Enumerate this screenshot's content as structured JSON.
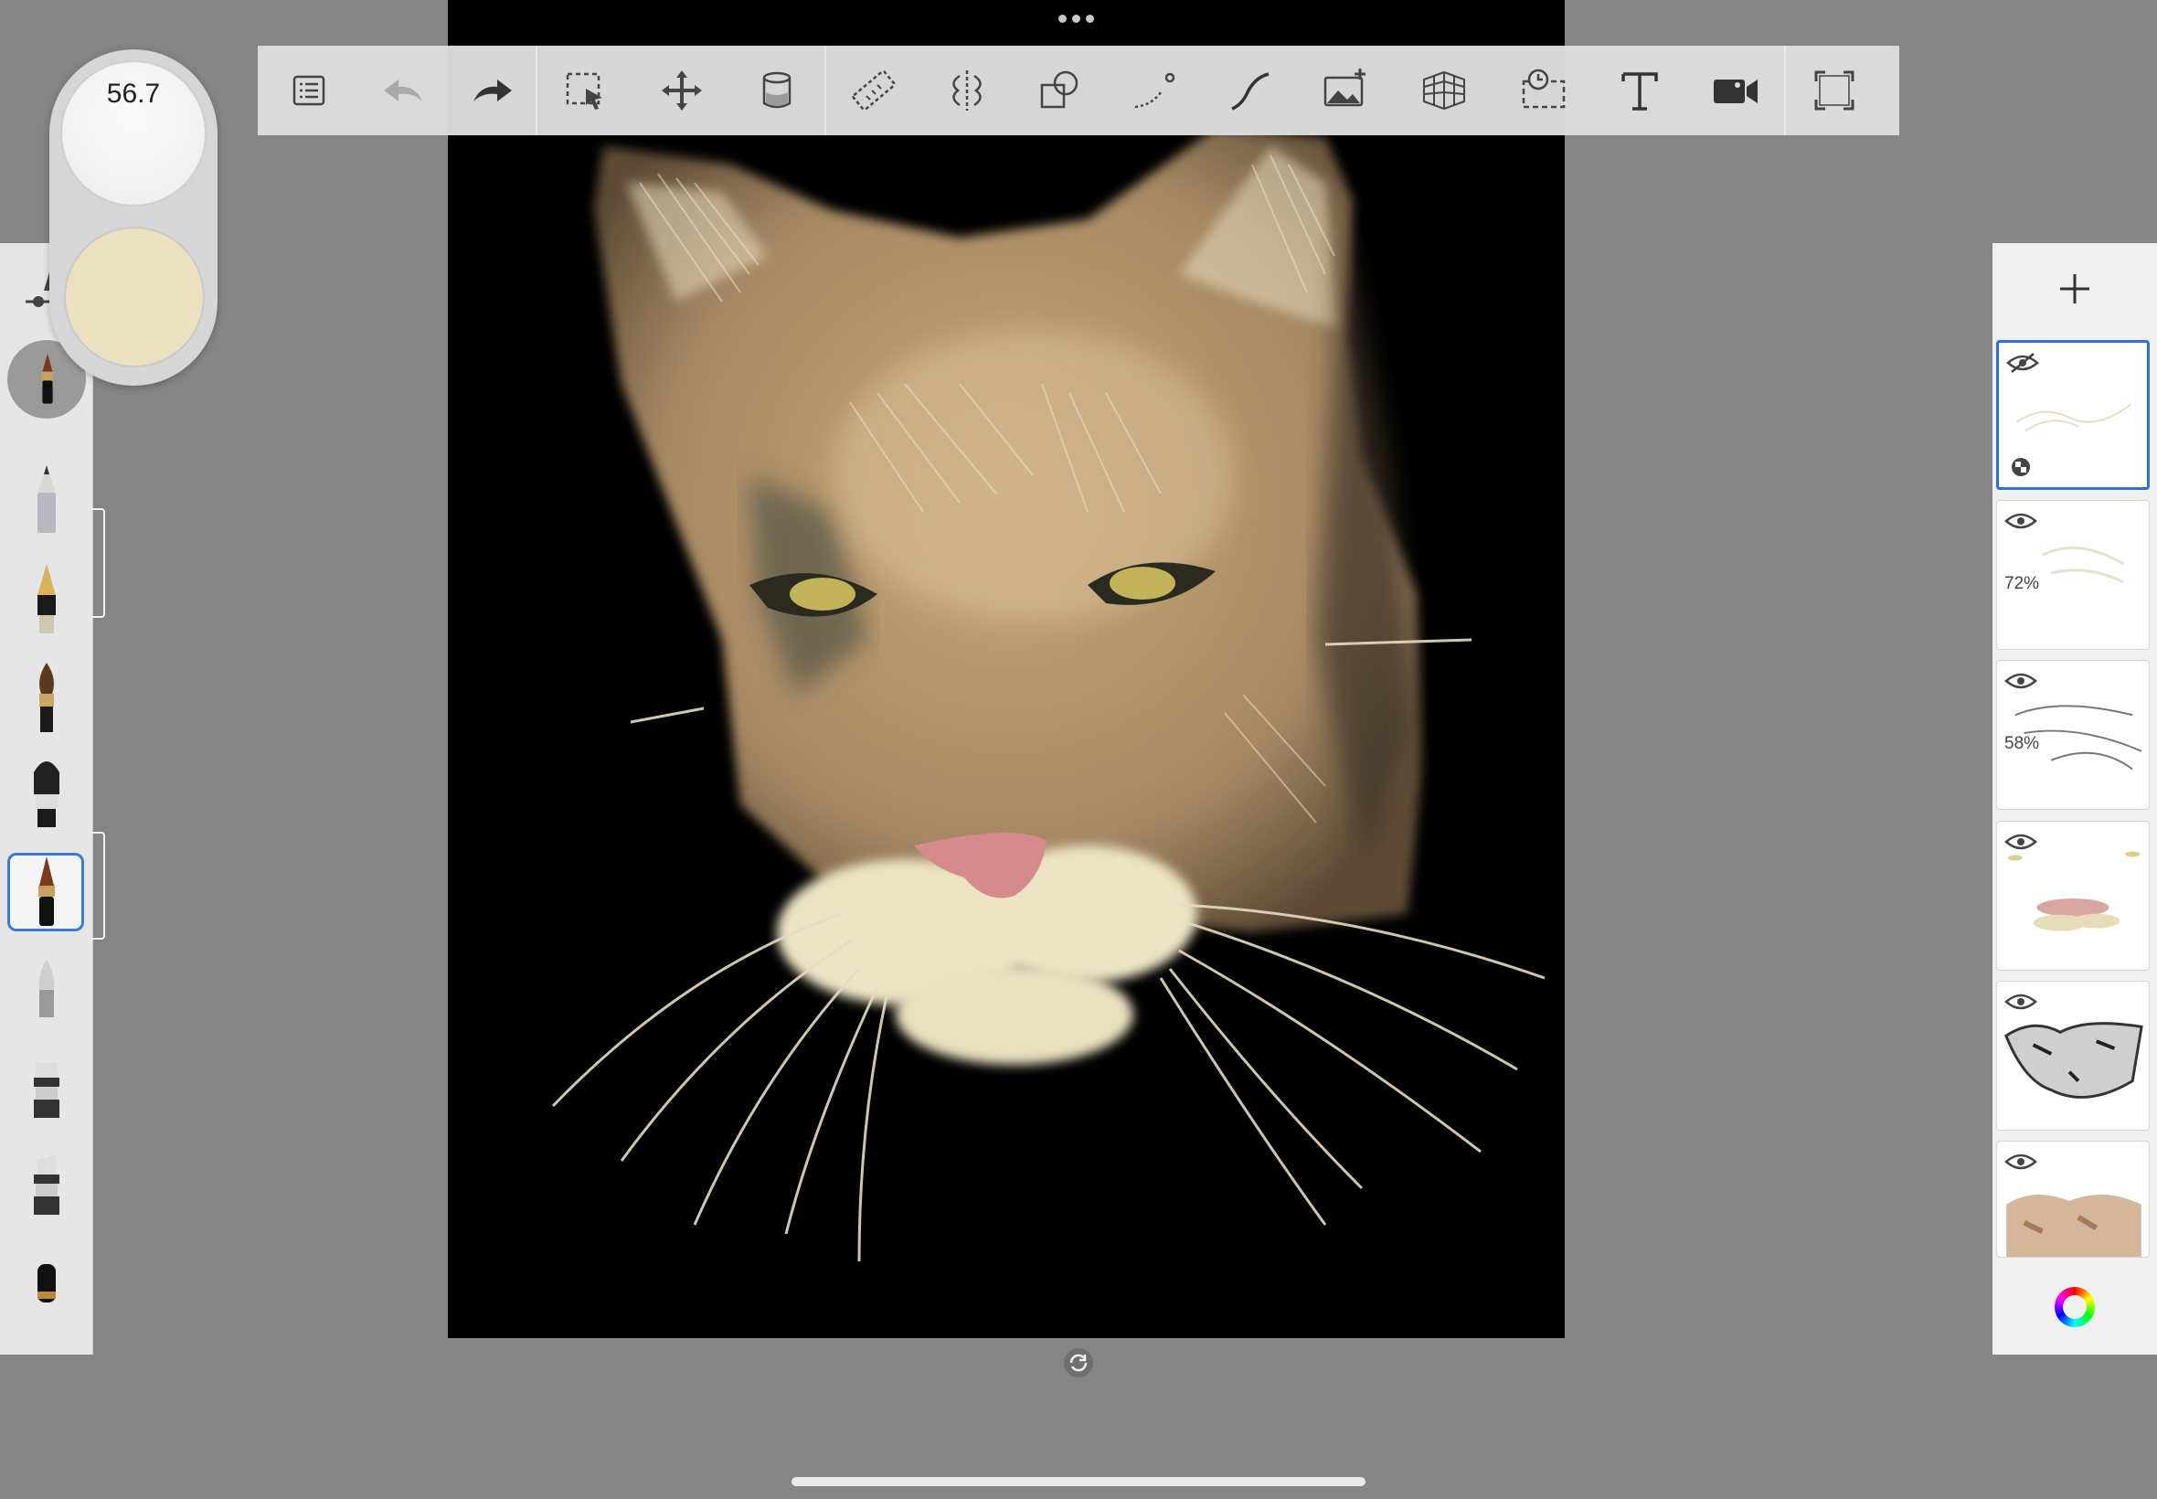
{
  "brush": {
    "size_value": "56.7",
    "current_color": "#ebe1c1"
  },
  "toolbar": {
    "items": [
      "list-icon",
      "undo-icon",
      "redo-icon",
      "selection-icon",
      "transform-icon",
      "fill-bucket-icon",
      "ruler-icon",
      "symmetry-icon",
      "shapes-icon",
      "stroke-path-icon",
      "curve-icon",
      "add-image-icon",
      "perspective-grid-icon",
      "time-lapse-icon",
      "text-icon",
      "video-record-icon",
      "fullscreen-icon"
    ]
  },
  "brushes": [
    "pencil-icon",
    "ballpoint-pen-icon",
    "fountain-pen-icon",
    "paint-brush-icon",
    "airbrush-icon",
    "fine-paint-brush-icon",
    "soft-tip-icon",
    "marker-icon",
    "chisel-marker-icon",
    "eraser-icon"
  ],
  "layers": [
    {
      "visible": false,
      "opacity_label": "",
      "selected": true
    },
    {
      "visible": true,
      "opacity_label": "72%",
      "selected": false
    },
    {
      "visible": true,
      "opacity_label": "58%",
      "selected": false
    },
    {
      "visible": true,
      "opacity_label": "",
      "selected": false
    },
    {
      "visible": true,
      "opacity_label": "",
      "selected": false
    },
    {
      "visible": true,
      "opacity_label": "",
      "selected": false
    }
  ],
  "colors": {
    "accent": "#3a7bd5",
    "canvas_background": "#000000",
    "workspace": "#858585"
  }
}
